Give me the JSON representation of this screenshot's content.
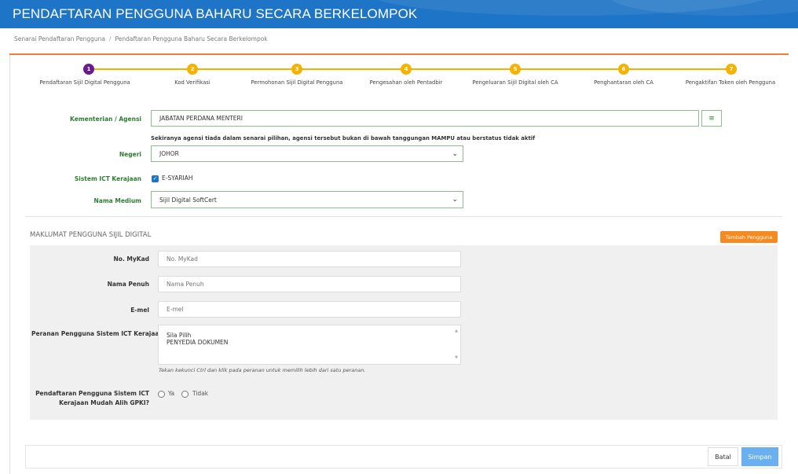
{
  "header": {
    "title": "PENDAFTARAN PENGGUNA BAHARU SECARA BERKELOMPOK"
  },
  "breadcrumb": {
    "items": [
      "Senarai Pendaftaran Pengguna",
      "Pendaftaran Pengguna Baharu Secara Berkelompok"
    ],
    "separator": "/"
  },
  "stepper": {
    "steps": [
      {
        "num": "1",
        "label": "Pendaftaran Sijil Digital Pengguna"
      },
      {
        "num": "2",
        "label": "Kod Verifikasi"
      },
      {
        "num": "3",
        "label": "Permohonan Sijil Digital Pengguna"
      },
      {
        "num": "4",
        "label": "Pengesahan oleh Pentadbir"
      },
      {
        "num": "5",
        "label": "Pengeluaran Sijil Digital oleh CA"
      },
      {
        "num": "6",
        "label": "Penghantaran oleh CA"
      },
      {
        "num": "7",
        "label": "Pengaktifan Token oleh Pengguna"
      }
    ]
  },
  "form": {
    "agency_label": "Kementerian / Agensi",
    "agency_value": "JABATAN PERDANA MENTERI",
    "agency_note": "Sekiranya agensi tiada dalam senarai pilihan, agensi tersebut bukan di bawah tanggungan MAMPU atau berstatus tidak aktif",
    "state_label": "Negeri",
    "state_value": "JOHOR",
    "ict_label": "Sistem ICT Kerajaan",
    "ict_checkbox_label": "E-SYARIAH",
    "medium_label": "Nama Medium",
    "medium_value": "Sijil Digital SoftCert"
  },
  "user_section": {
    "title": "MAKLUMAT PENGGUNA SIJIL DIGITAL",
    "add_button": "Tambah Pengguna",
    "mykad_label": "No. MyKad",
    "mykad_placeholder": "No. MyKad",
    "name_label": "Nama Penuh",
    "name_placeholder": "Nama Penuh",
    "email_label": "E-mel",
    "email_placeholder": "E-mel",
    "role_label": "Peranan Pengguna Sistem ICT Kerajaan",
    "role_options": [
      "Sila Pilih",
      "PENYEDIA DOKUMEN"
    ],
    "role_hint": "Tekan kekunci Ctrl dan klik pada peranan untuk memilih lebih dari satu peranan.",
    "mobile_label_1": "Pendaftaran Pengguna Sistem ICT",
    "mobile_label_2": "Kerajaan Mudah Alih GPKI?",
    "radio_yes": "Ya",
    "radio_no": "Tidak"
  },
  "footer": {
    "cancel": "Batal",
    "save": "Simpan"
  },
  "colors": {
    "header_bg": "#1e74c6",
    "accent_orange": "#f58a1f",
    "step_active": "#6a1b8a",
    "step_pending": "#f6b200",
    "label_green": "#2e7d32",
    "save_btn": "#6ab0f0"
  }
}
